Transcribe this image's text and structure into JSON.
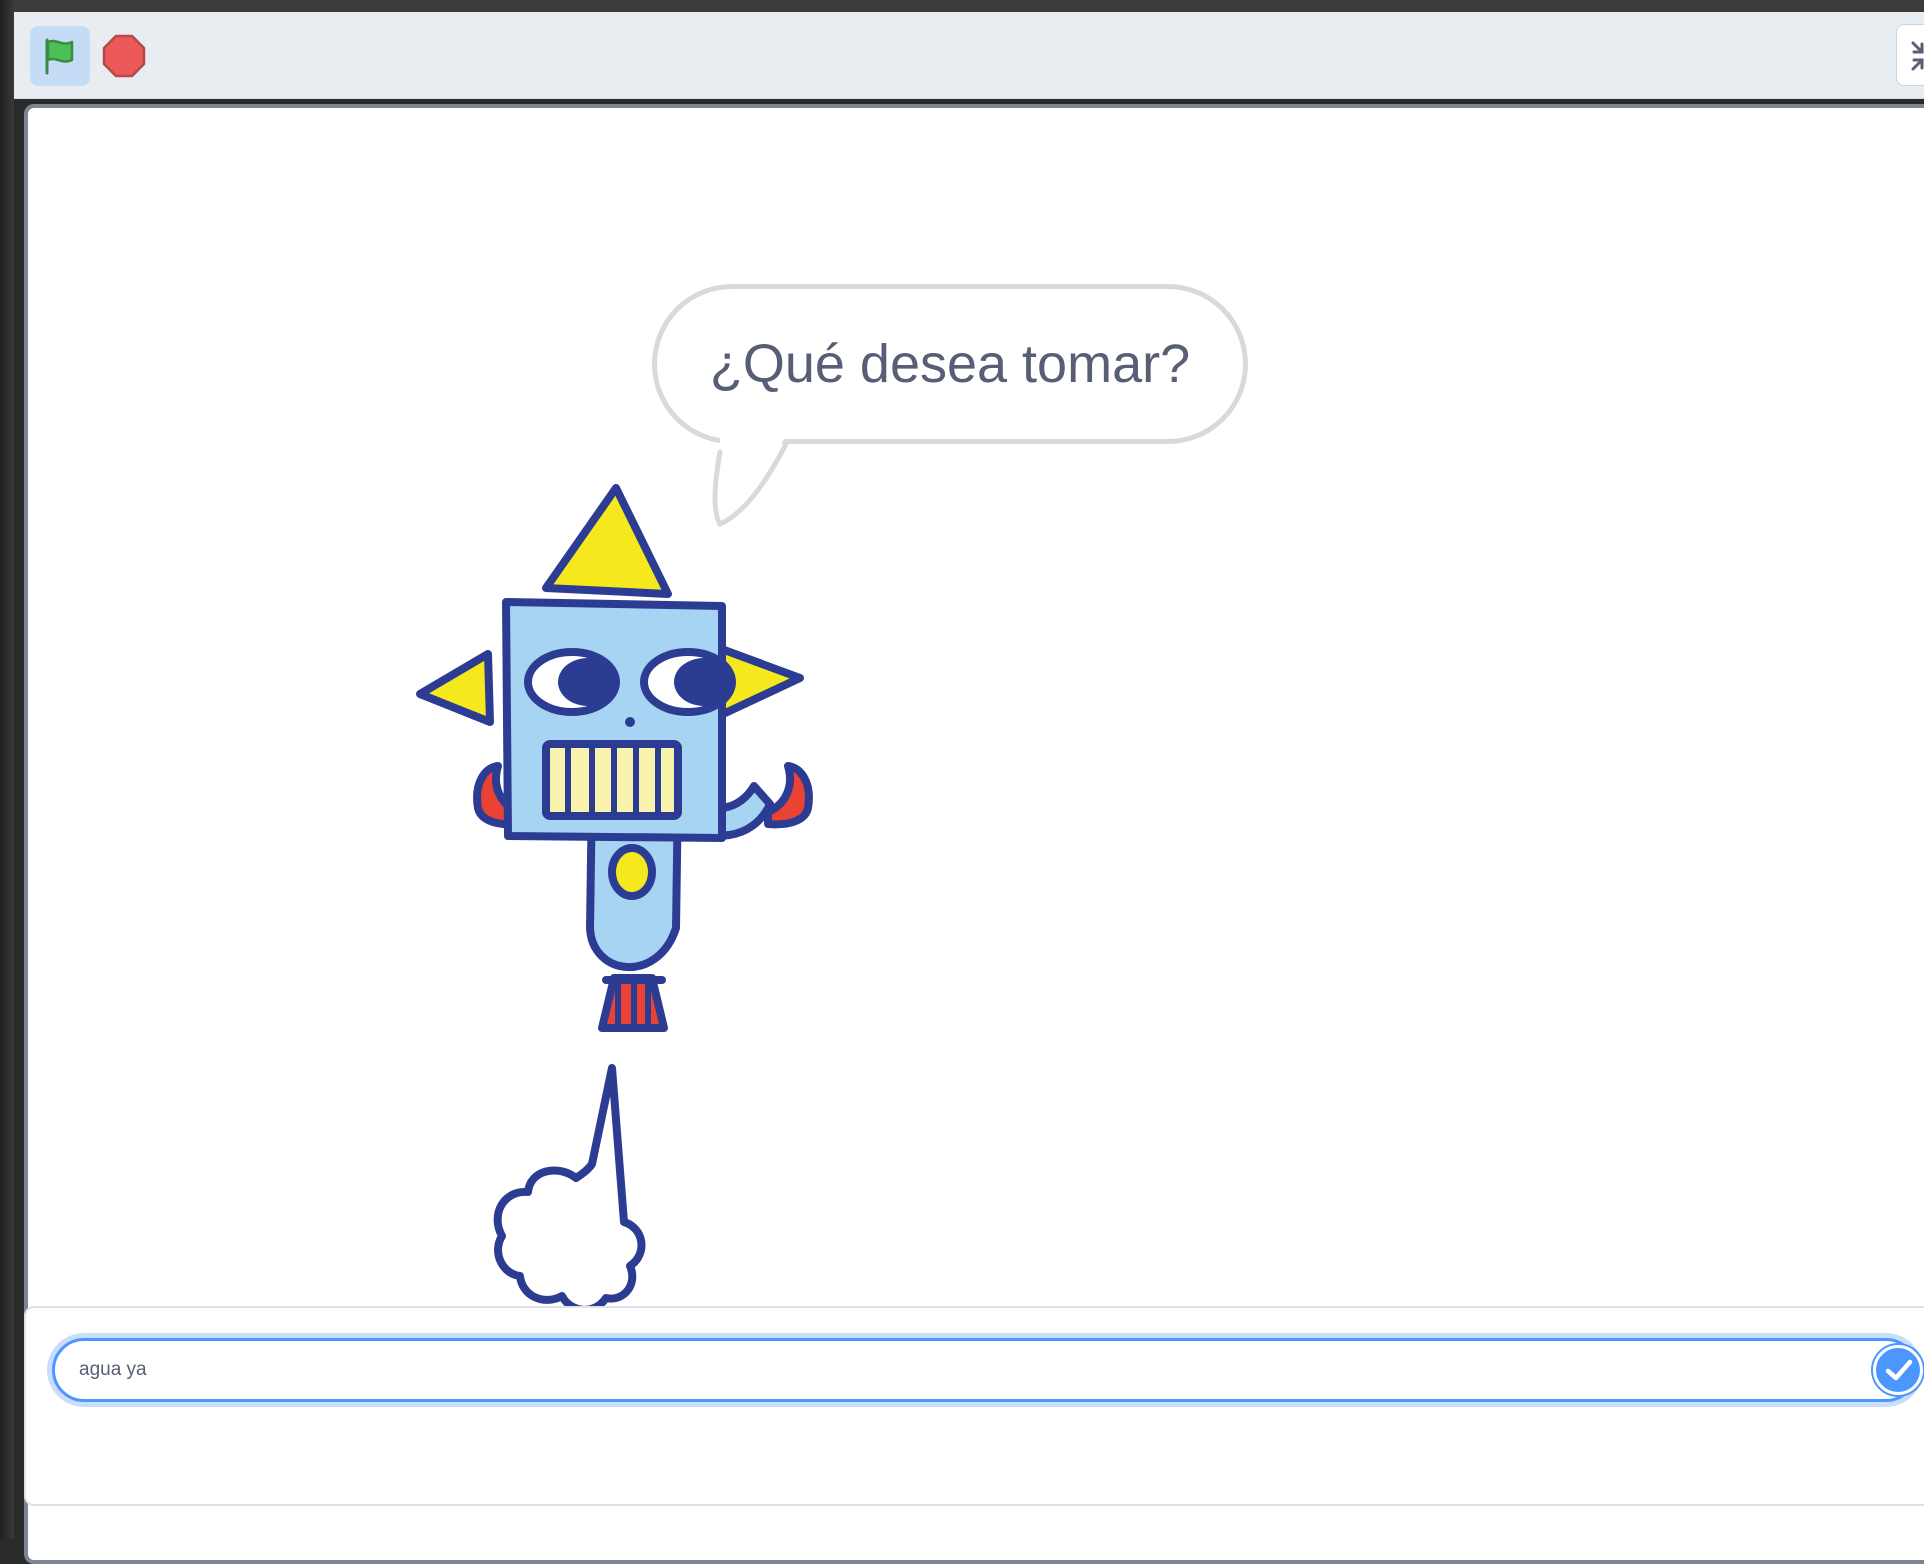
{
  "toolbar": {
    "green_flag_icon": "green-flag-icon",
    "stop_icon": "stop-sign-icon",
    "fullscreen_icon": "exit-fullscreen-icon"
  },
  "stage": {
    "speech_bubble": {
      "text": "¿Qué desea tomar?"
    },
    "sprite": "robot"
  },
  "ask_prompt": {
    "answer_value": "agua ya",
    "submit_icon": "checkmark-icon"
  },
  "colors": {
    "accent": "#4c97ff",
    "flag_green": "#4cbf56",
    "stop_red": "#ec5959",
    "text": "#575e75",
    "toolbar_bg": "#e8edf2"
  }
}
